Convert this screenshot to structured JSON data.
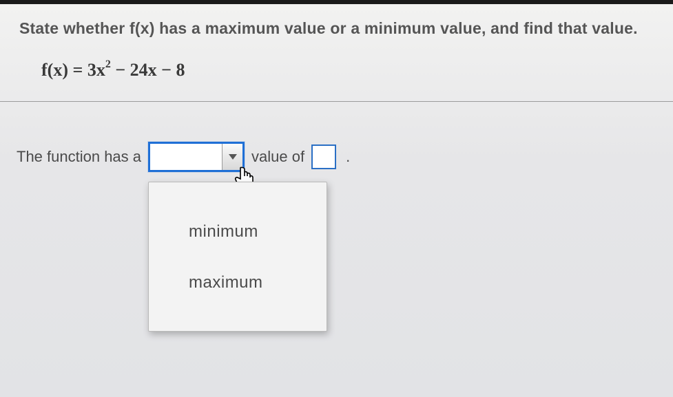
{
  "prompt": "State whether f(x) has a maximum value or a minimum value, and find that value.",
  "equation": {
    "lhs": "f(x)",
    "rhs_a": "3x",
    "rhs_exp": "2",
    "rhs_rest": " − 24x − 8"
  },
  "answer": {
    "prefix": "The function has a",
    "combo_value": "",
    "mid": "value of",
    "value": "",
    "period": "."
  },
  "dropdown": {
    "options": [
      "minimum",
      "maximum"
    ]
  }
}
